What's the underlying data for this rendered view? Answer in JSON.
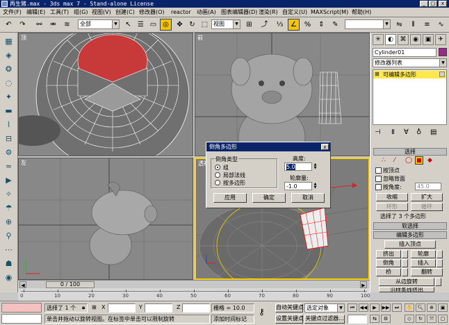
{
  "titlebar": {
    "title": "再生猪.max - 3ds max 7 - Stand-alone License",
    "minimize_label": "_",
    "maximize_label": "□",
    "close_label": "x"
  },
  "menu": [
    "文件(F)",
    "编辑(E)",
    "工具(T)",
    "组(G)",
    "视图(V)",
    "创建(C)",
    "修改器(O)",
    "reactor",
    "动画(A)",
    "图表编辑器(D)",
    "渲染(R)",
    "自定义(U)",
    "MAXScript(M)",
    "帮助(H)"
  ],
  "toolbar": {
    "selection_filter": "全部",
    "ref_coord": "视图",
    "named_selection_placeholder": ""
  },
  "viewports": {
    "top_label": "顶",
    "front_label": "前",
    "left_label": "左",
    "persp_label": "透视"
  },
  "command_panel": {
    "object_name": "Cylinder01",
    "modifier_list": "修改器列表",
    "stack_item": "可编辑多边形",
    "selection_rollout": "选择",
    "by_vertex": "按顶点",
    "ignore_backfacing": "忽略背面",
    "by_angle": "按角度:",
    "angle_value": "45.0",
    "shrink": "收缩",
    "grow": "扩大",
    "ring": "环形",
    "loop": "循环",
    "selection_info": "选择了 3 个多边形",
    "soft_selection_rollout": "软选择",
    "edit_polygons_rollout": "编辑多边形",
    "insert_vertex": "插入顶点",
    "extrude": "挤出",
    "outline": "轮廓",
    "bevel": "倒角",
    "inset": "插入",
    "bridge": "桥",
    "flip": "翻转",
    "hinge_from_edge": "从边旋转",
    "extrude_along_spline": "沿样条线挤出"
  },
  "dialog": {
    "title": "倒角多边形",
    "close_label": "x",
    "group_title": "倒角类型",
    "option_group": "组",
    "option_local_normal": "局部法线",
    "option_by_polygon": "按多边形",
    "height_label": "高度:",
    "height_value": "5.0",
    "outline_label": "轮廓量:",
    "outline_value": "-1.0",
    "apply_label": "应用",
    "ok_label": "确定",
    "cancel_label": "取消",
    "selected_option": "组"
  },
  "timeline": {
    "slider_label": "0 / 100",
    "ticks": [
      "0",
      "10",
      "20",
      "30",
      "40",
      "50",
      "60",
      "70",
      "80",
      "90",
      "100"
    ]
  },
  "status": {
    "selected": "选择了 1 个",
    "x_label": "X",
    "y_label": "Y",
    "z_label": "Z",
    "grid": "栅格 = 10.0",
    "auto_key": "自动关键点",
    "set_key": "设置关键点",
    "selected_object": "选定对象",
    "key_filters": "关键点过滤器...",
    "prompt": "单击并拖动以旋转视图。在标签中单击可以限制旋转",
    "add_time_tag": "添加时间标记"
  }
}
